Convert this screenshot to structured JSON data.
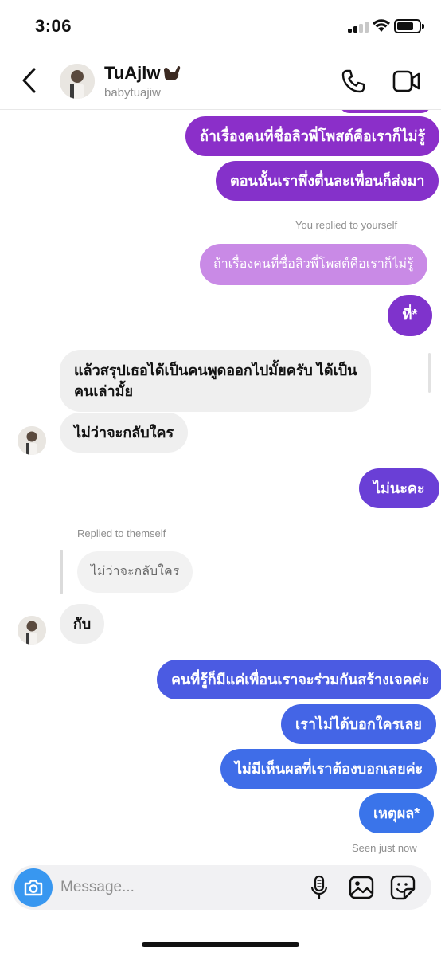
{
  "status_bar": {
    "time": "3:06"
  },
  "header": {
    "name": "TuAjlw",
    "username": "babytuajiw",
    "icons": [
      "back-icon",
      "call-icon",
      "video-call-icon",
      "call-me-hand-icon"
    ]
  },
  "messages": {
    "sent_1": "ถ้าเรื่องคนที่ชื่อลิวพี่โพสต์คือเราก็ไม่รู้",
    "sent_2": "ตอนนั้นเราพึ่งตื่นละเพื่อนก็ส่งมา",
    "reply_note_self": "You replied to yourself",
    "reply_quote_self": "ถ้าเรื่องคนที่ชื่อลิวพี่โพสต์คือเราก็ไม่รู้",
    "sent_3": "ที่*",
    "recv_1_line1": "แล้วสรุปเธอได้เป็นคนพูดออกไปมั้ยครับ ได้เป็น",
    "recv_1_line2": "คนเล่ามั้ย",
    "recv_2": "ไม่ว่าจะกลับใคร",
    "sent_4": "ไม่นะคะ",
    "reply_note_them": "Replied to themself",
    "reply_quote_them": "ไม่ว่าจะกลับใคร",
    "recv_3": "กับ",
    "sent_5": "คนที่รู้ก็มีแค่เพื่อนเราจะร่วมกันสร้างเจคค่ะ",
    "sent_6": "เราไม่ได้บอกใครเลย",
    "sent_7": "ไม่มีเห็นผลที่เราต้องบอกเลยค่ะ",
    "sent_8": "เหตุผล*",
    "seen": "Seen just now"
  },
  "composer": {
    "placeholder": "Message...",
    "icons": [
      "camera-icon",
      "microphone-icon",
      "gallery-icon",
      "sticker-icon"
    ]
  },
  "colors": {
    "gradient_top": "#8f2fc7",
    "gradient_mid": "#6a3fd6",
    "gradient_bottom": "#3d6fe8",
    "reply_faded": "#c98ae6",
    "received_bg": "#efefef",
    "camera_button": "#3897f0"
  }
}
